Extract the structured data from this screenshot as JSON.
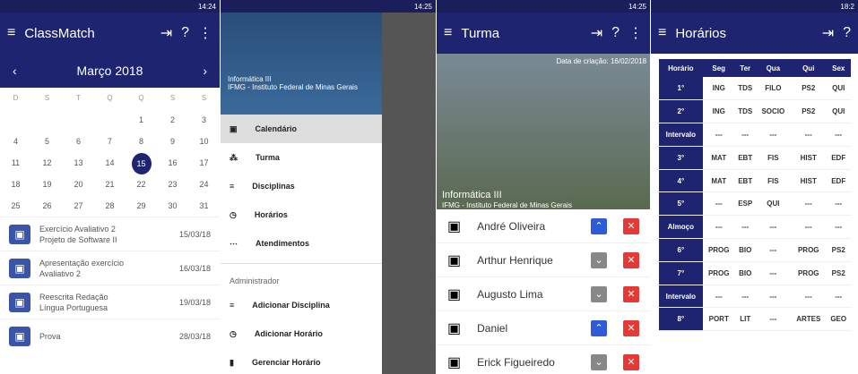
{
  "p1": {
    "time": "14:24",
    "title": "ClassMatch",
    "month": "Março 2018",
    "days_h": [
      "D",
      "S",
      "T",
      "Q",
      "Q",
      "S",
      "S"
    ],
    "days": [
      "",
      "",
      "",
      "",
      "1",
      "2",
      "3",
      "4",
      "5",
      "6",
      "7",
      "8",
      "9",
      "10",
      "11",
      "12",
      "13",
      "14",
      "15",
      "16",
      "17",
      "18",
      "19",
      "20",
      "21",
      "22",
      "23",
      "24",
      "25",
      "26",
      "27",
      "28",
      "29",
      "30",
      "31"
    ],
    "events": [
      {
        "t": "Exercício Avaliativo 2",
        "s": "Projeto de Software II",
        "d": "15/03/18"
      },
      {
        "t": "Apresentação exercício",
        "s": "Avaliativo 2",
        "d": "16/03/18"
      },
      {
        "t": "Reescrita Redação",
        "s": "Língua Portuguesa",
        "d": "19/03/18"
      },
      {
        "t": "Prova",
        "s": "",
        "d": "28/03/18"
      }
    ]
  },
  "p2": {
    "time": "14:25",
    "name": "Informática III",
    "inst": "IFMG - Instituto Federal de Minas Gerais",
    "items": [
      "Calendário",
      "Turma",
      "Disciplinas",
      "Horários",
      "Atendimentos"
    ],
    "admin": "Administrador",
    "admin_items": [
      "Adicionar Disciplina",
      "Adicionar Horário",
      "Gerenciar Horário"
    ]
  },
  "p3": {
    "time": "14:25",
    "title": "Turma",
    "date": "Data de criação: 16/02/2018",
    "cls": "Informática III",
    "inst": "IFMG - Instituto Federal de Minas Gerais",
    "students": [
      "André Oliveira",
      "Arthur Henrique",
      "Augusto Lima",
      "Daniel",
      "Erick Figueiredo"
    ]
  },
  "p4": {
    "time": "18:2",
    "title": "Horários",
    "head": [
      "Horário",
      "Seg",
      "Ter",
      "Qua",
      "Qui",
      "Sex"
    ],
    "rows": [
      [
        "1°",
        "ING",
        "TDS",
        "FILO",
        "PS2",
        "QUI"
      ],
      [
        "2°",
        "ING",
        "TDS",
        "SOCIO",
        "PS2",
        "QUI"
      ],
      [
        "Intervalo",
        "---",
        "---",
        "---",
        "---",
        "---"
      ],
      [
        "3°",
        "MAT",
        "EBT",
        "FIS",
        "HIST",
        "EDF"
      ],
      [
        "4°",
        "MAT",
        "EBT",
        "FIS",
        "HIST",
        "EDF"
      ],
      [
        "5°",
        "---",
        "ESP",
        "QUI",
        "---",
        "---"
      ],
      [
        "Almoço",
        "---",
        "---",
        "---",
        "---",
        "---"
      ],
      [
        "6°",
        "PROG",
        "BIO",
        "---",
        "PROG",
        "PS2"
      ],
      [
        "7°",
        "PROG",
        "BIO",
        "---",
        "PROG",
        "PS2"
      ],
      [
        "Intervalo",
        "---",
        "---",
        "---",
        "---",
        "---"
      ],
      [
        "8°",
        "PORT",
        "LIT",
        "---",
        "ARTES",
        "GEO"
      ]
    ]
  }
}
